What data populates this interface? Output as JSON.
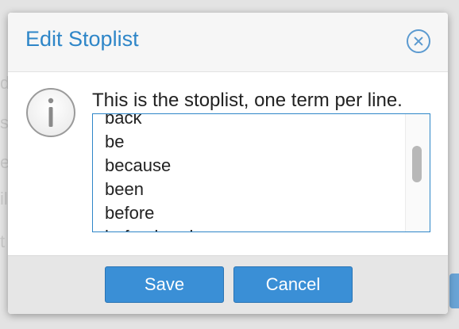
{
  "dialog": {
    "title": "Edit Stoplist",
    "message": "This is the stoplist, one term per line.",
    "stoplist_terms": [
      "back",
      "be",
      "because",
      "been",
      "before",
      "beforehand"
    ],
    "save_label": "Save",
    "cancel_label": "Cancel"
  },
  "icons": {
    "close": "close-circle-icon",
    "info": "info-circle-icon"
  },
  "colors": {
    "accent": "#2e86c8",
    "button": "#3a8fd6"
  }
}
